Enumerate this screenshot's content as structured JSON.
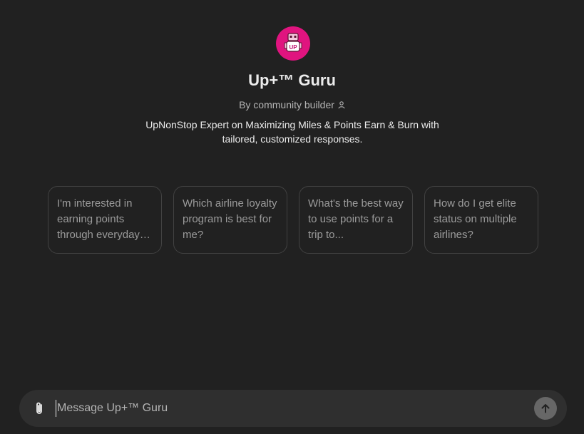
{
  "gpt": {
    "name": "Up+™ Guru",
    "byline": "By community builder",
    "description": "UpNonStop Expert on Maximizing Miles & Points Earn & Burn with tailored, customized responses.",
    "avatar_icon": "robot-logo-icon",
    "avatar_text": "UP"
  },
  "starters": [
    {
      "text": "I'm interested in earning points through everyday spending."
    },
    {
      "text": "Which airline loyalty program is best for me?"
    },
    {
      "text": "What's the best way to use points for a trip to..."
    },
    {
      "text": "How do I get elite status on multiple airlines?"
    }
  ],
  "composer": {
    "placeholder": "Message Up+™ Guru",
    "attach_icon": "paperclip-icon",
    "send_icon": "arrow-up-icon"
  },
  "colors": {
    "background": "#212121",
    "avatar": "#e0147f",
    "composer": "#2f2f2f",
    "send_button": "#676767"
  }
}
